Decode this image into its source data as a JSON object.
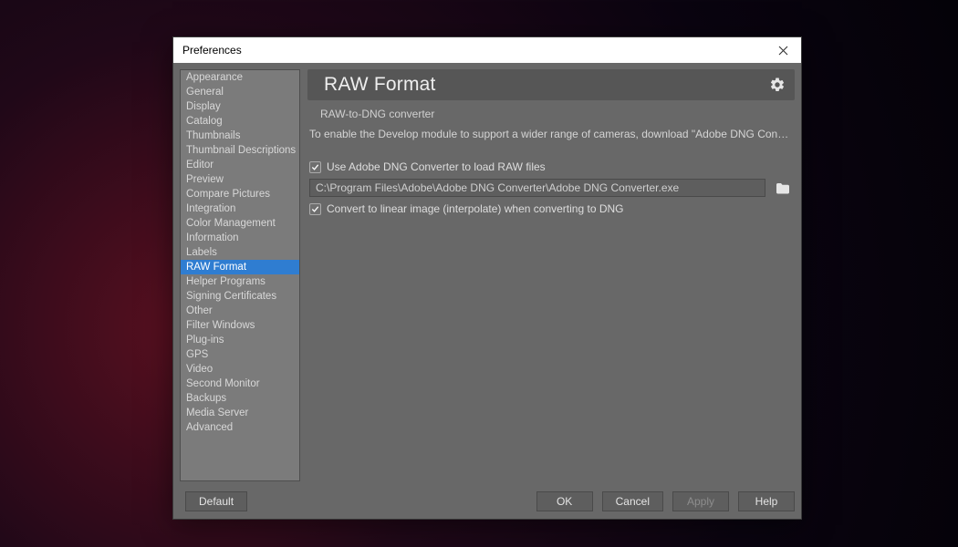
{
  "window": {
    "title": "Preferences"
  },
  "sidebar": {
    "items": [
      {
        "label": "Appearance"
      },
      {
        "label": "General"
      },
      {
        "label": "Display"
      },
      {
        "label": "Catalog"
      },
      {
        "label": "Thumbnails"
      },
      {
        "label": "Thumbnail Descriptions"
      },
      {
        "label": "Editor"
      },
      {
        "label": "Preview"
      },
      {
        "label": "Compare Pictures"
      },
      {
        "label": "Integration"
      },
      {
        "label": "Color Management"
      },
      {
        "label": "Information"
      },
      {
        "label": "Labels"
      },
      {
        "label": "RAW Format",
        "selected": true
      },
      {
        "label": "Helper Programs"
      },
      {
        "label": "Signing Certificates"
      },
      {
        "label": "Other"
      },
      {
        "label": "Filter Windows"
      },
      {
        "label": "Plug-ins"
      },
      {
        "label": "GPS"
      },
      {
        "label": "Video"
      },
      {
        "label": "Second Monitor"
      },
      {
        "label": "Backups"
      },
      {
        "label": "Media Server"
      },
      {
        "label": "Advanced"
      }
    ]
  },
  "page": {
    "title": "RAW Format",
    "section_title": "RAW-to-DNG converter",
    "description": "To enable the Develop module to support a wider range of cameras, download \"Adobe DNG Convert...",
    "checkbox_use_converter": {
      "checked": true,
      "label": "Use Adobe DNG Converter to load RAW files"
    },
    "path_value": "C:\\Program Files\\Adobe\\Adobe DNG Converter\\Adobe DNG Converter.exe",
    "checkbox_linear": {
      "checked": true,
      "label": "Convert to linear image (interpolate) when converting to DNG"
    }
  },
  "footer": {
    "default": "Default",
    "ok": "OK",
    "cancel": "Cancel",
    "apply": "Apply",
    "help": "Help"
  }
}
